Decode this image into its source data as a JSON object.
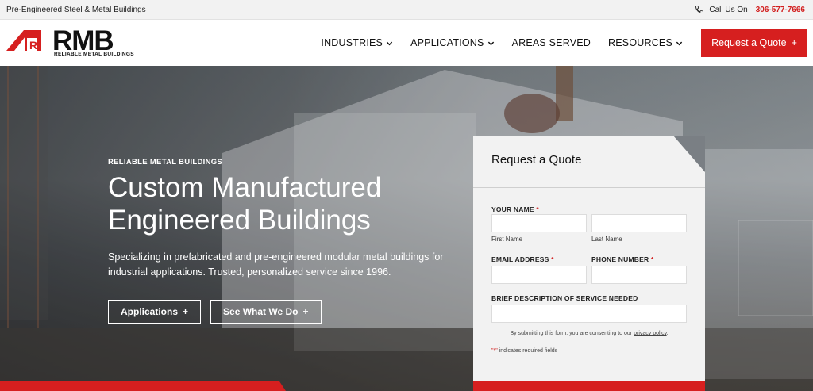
{
  "topbar": {
    "tagline": "Pre-Engineered Steel & Metal Buildings",
    "call_label": "Call Us On",
    "phone": "306-577-7666"
  },
  "logo": {
    "wordmark": "RMB",
    "tagline": "RELIABLE METAL BUILDINGS"
  },
  "nav": {
    "items": [
      {
        "label": "INDUSTRIES",
        "has_dropdown": true
      },
      {
        "label": "APPLICATIONS",
        "has_dropdown": true
      },
      {
        "label": "AREAS SERVED",
        "has_dropdown": false
      },
      {
        "label": "RESOURCES",
        "has_dropdown": true
      }
    ],
    "quote_button": "Request a Quote",
    "quote_icon": "+"
  },
  "hero": {
    "eyebrow": "RELIABLE METAL BUILDINGS",
    "headline_line1": "Custom Manufactured",
    "headline_line2": "Engineered Buildings",
    "lede": "Specializing in prefabricated and pre-engineered modular metal buildings for industrial applications. Trusted, personalized service since 1996.",
    "buttons": [
      {
        "label": "Applications",
        "icon": "+"
      },
      {
        "label": "See What We Do",
        "icon": "+"
      }
    ]
  },
  "form": {
    "title": "Request a Quote",
    "name_label": "YOUR NAME",
    "first_name_sub": "First Name",
    "last_name_sub": "Last Name",
    "email_label": "EMAIL ADDRESS",
    "phone_label": "PHONE NUMBER",
    "desc_label": "BRIEF DESCRIPTION OF SERVICE NEEDED",
    "required_mark": "*",
    "consent_text": "By submitting this form, you are consenting to our",
    "consent_link": "privacy policy",
    "consent_end": ".",
    "required_note_mark": "\"*\"",
    "required_note": " indicates required fields"
  },
  "colors": {
    "accent": "#d61f1f",
    "text": "#111111",
    "card_bg": "#f2f2f2"
  }
}
